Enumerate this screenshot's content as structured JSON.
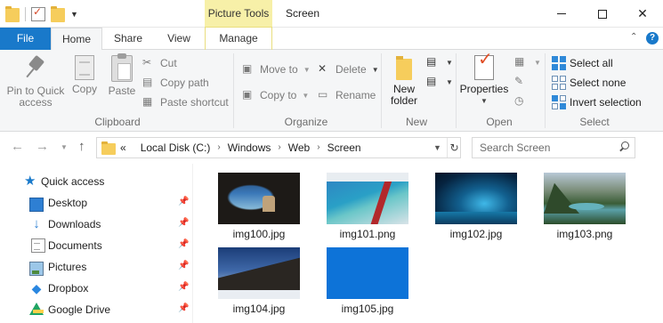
{
  "titlebar": {
    "context_tab": "Picture Tools",
    "window_title": "Screen"
  },
  "ribbon_tabs": {
    "file": "File",
    "home": "Home",
    "share": "Share",
    "view": "View",
    "manage": "Manage"
  },
  "ribbon": {
    "clipboard": {
      "label": "Clipboard",
      "pin_line1": "Pin to Quick",
      "pin_line2": "access",
      "copy": "Copy",
      "paste": "Paste",
      "cut": "Cut",
      "copy_path": "Copy path",
      "paste_shortcut": "Paste shortcut"
    },
    "organize": {
      "label": "Organize",
      "move_to": "Move to",
      "copy_to": "Copy to",
      "delete": "Delete",
      "rename": "Rename"
    },
    "new": {
      "label": "New",
      "new_folder_line1": "New",
      "new_folder_line2": "folder"
    },
    "open": {
      "label": "Open",
      "properties": "Properties"
    },
    "select": {
      "label": "Select",
      "select_all": "Select all",
      "select_none": "Select none",
      "invert_selection": "Invert selection"
    }
  },
  "addressbar": {
    "overflow": "«",
    "crumbs": [
      "Local Disk (C:)",
      "Windows",
      "Web",
      "Screen"
    ],
    "search_placeholder": "Search Screen"
  },
  "sidebar": {
    "quick_access": "Quick access",
    "items": [
      {
        "label": "Desktop",
        "icon": "desktop-icon",
        "pinned": true
      },
      {
        "label": "Downloads",
        "icon": "downloads-icon",
        "pinned": true
      },
      {
        "label": "Documents",
        "icon": "documents-icon",
        "pinned": true
      },
      {
        "label": "Pictures",
        "icon": "pictures-icon",
        "pinned": true
      },
      {
        "label": "Dropbox",
        "icon": "dropbox-icon",
        "pinned": true
      },
      {
        "label": "Google Drive",
        "icon": "google-drive-icon",
        "pinned": true
      }
    ]
  },
  "files": [
    {
      "name": "img100.jpg"
    },
    {
      "name": "img101.png"
    },
    {
      "name": "img102.jpg"
    },
    {
      "name": "img103.png"
    },
    {
      "name": "img104.jpg"
    },
    {
      "name": "img105.jpg"
    }
  ],
  "colors": {
    "accent": "#1979ca",
    "context_tab": "#f7f0a8",
    "img105_fill": "#0d73d8"
  }
}
